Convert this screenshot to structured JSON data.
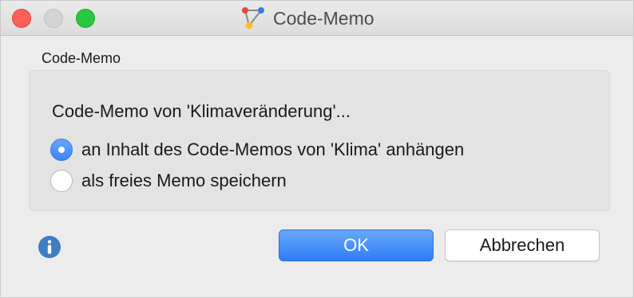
{
  "window": {
    "title": "Code-Memo"
  },
  "group": {
    "label": "Code-Memo"
  },
  "dialog": {
    "prompt": "Code-Memo von 'Klimaveränderung'...",
    "options": [
      {
        "label": "an Inhalt des Code-Memos von 'Klima' anhängen",
        "selected": true
      },
      {
        "label": "als freies Memo speichern",
        "selected": false
      }
    ]
  },
  "buttons": {
    "ok_label": "OK",
    "cancel_label": "Abbrechen"
  },
  "icons": {
    "title": "code-memo-app-icon",
    "info": "info-icon"
  },
  "colors": {
    "accent": "#3a82f6",
    "close": "#fe5f57",
    "zoom": "#28c840",
    "info": "#3f7dc4"
  }
}
